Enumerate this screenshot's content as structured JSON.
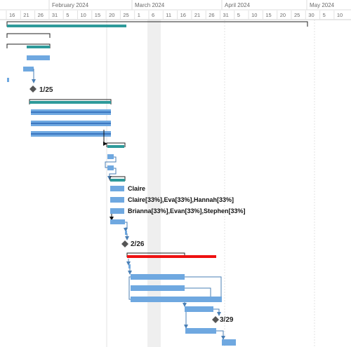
{
  "timescale": {
    "months": [
      {
        "label": "February 2024"
      },
      {
        "label": "March 2024"
      },
      {
        "label": "April 2024"
      },
      {
        "label": "May 2024"
      }
    ],
    "days": [
      "16",
      "21",
      "26",
      "31",
      "5",
      "10",
      "15",
      "20",
      "25",
      "1",
      "6",
      "11",
      "16",
      "21",
      "26",
      "31",
      "5",
      "10",
      "15",
      "20",
      "25",
      "30",
      "5",
      "10"
    ]
  },
  "milestones": [
    {
      "label": "1/25"
    },
    {
      "label": "2/26"
    },
    {
      "label": "3/29"
    }
  ],
  "resource_labels": [
    {
      "text": "Claire"
    },
    {
      "text": "Claire[33%],Eva[33%],Hannah[33%]"
    },
    {
      "text": "Brianna[33%],Evan[33%],Stephen[33%]"
    }
  ],
  "colors": {
    "task": "#6fa8e0",
    "task_dark": "#4a86c8",
    "summary_teal": "#2e9a9a",
    "critical": "#ee1111",
    "link": "#4a7fb5",
    "nonwork": "#efefef",
    "grid": "#e6e6e6"
  }
}
